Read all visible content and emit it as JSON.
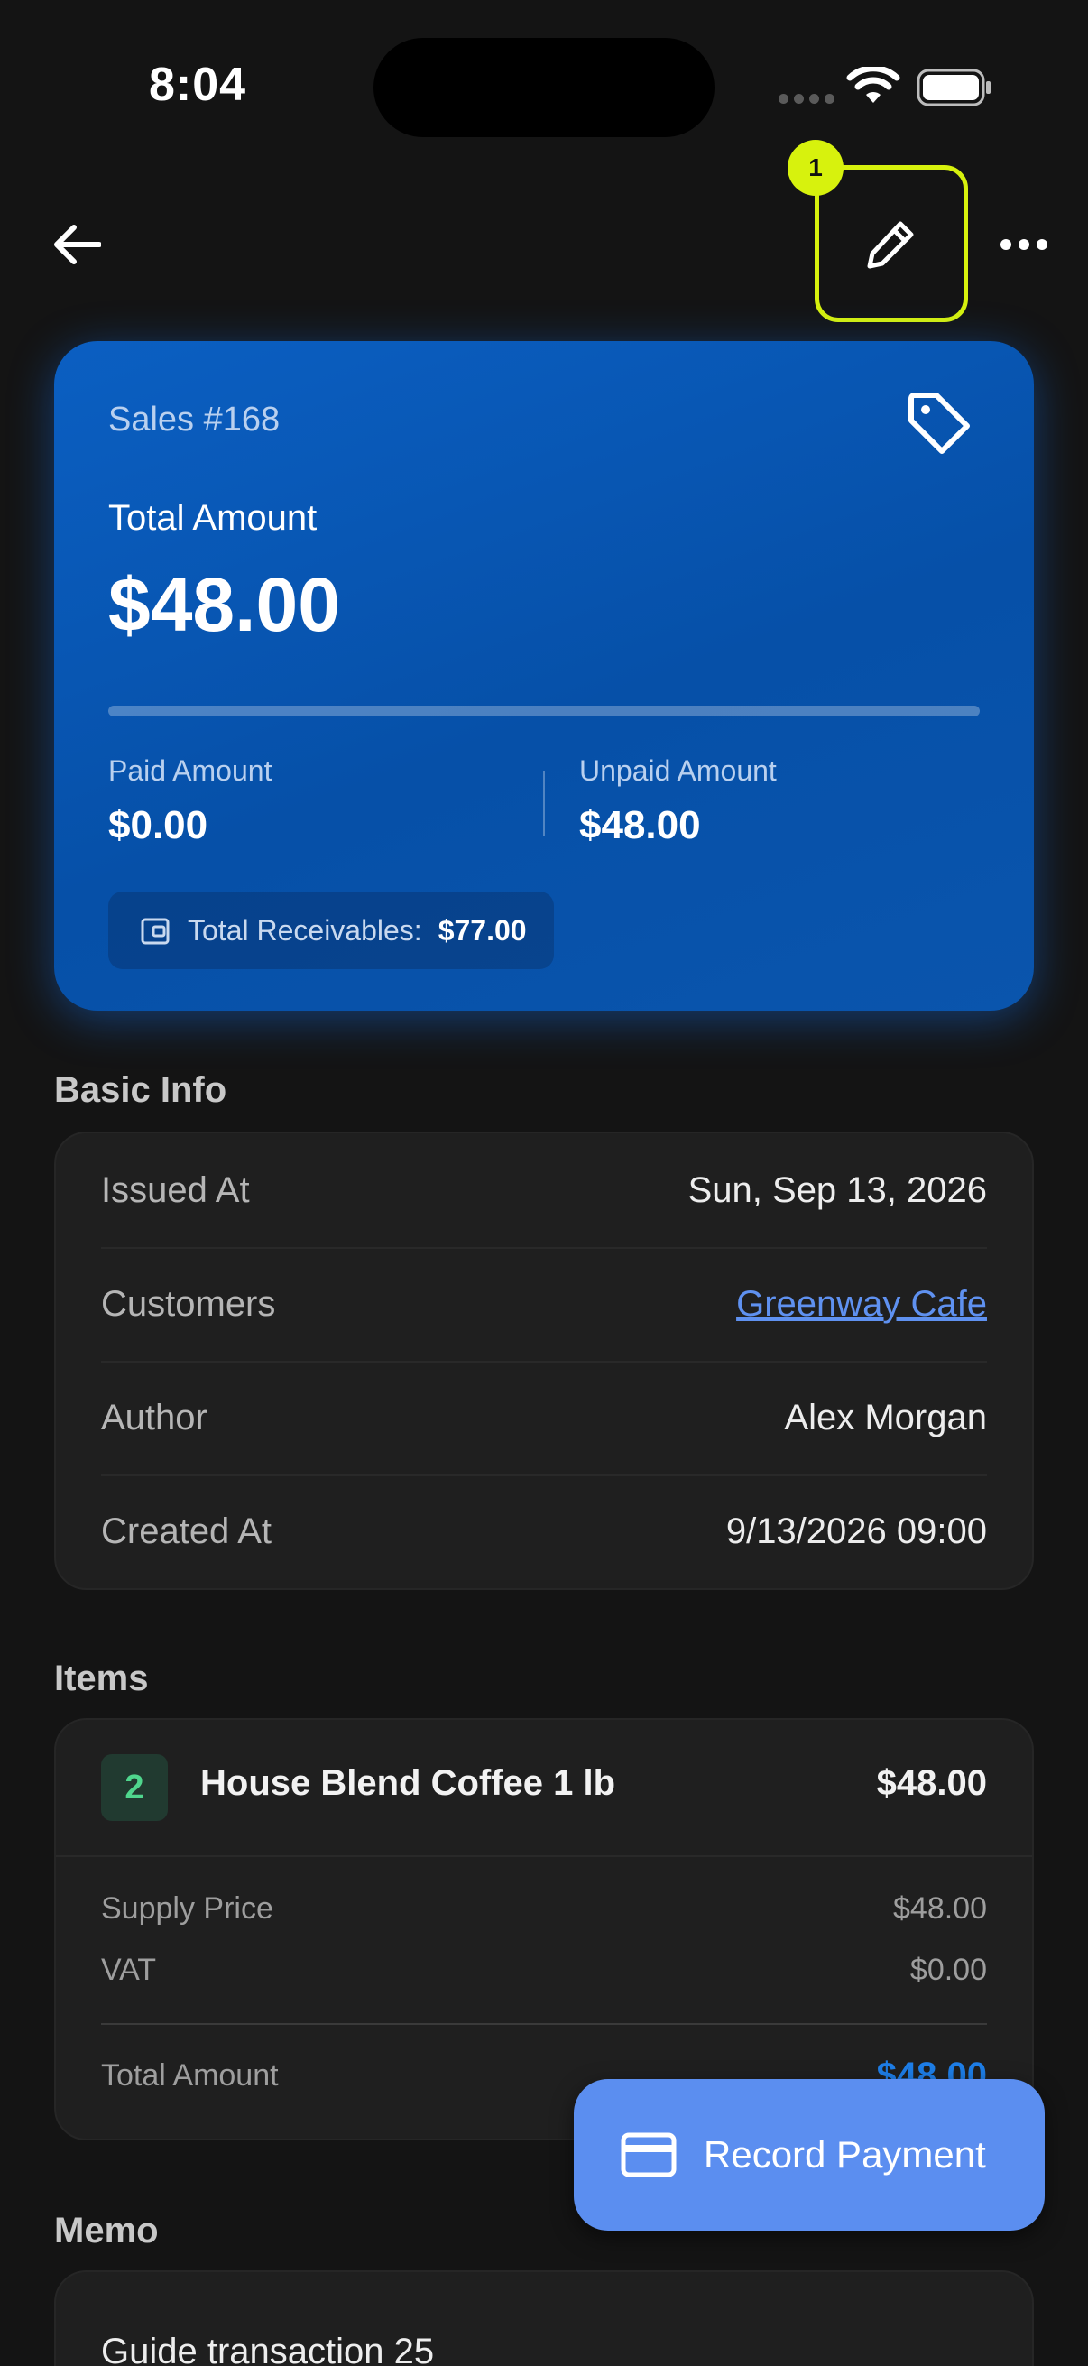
{
  "status_bar": {
    "time": "8:04"
  },
  "nav": {
    "edit_badge": "1"
  },
  "summary": {
    "sale_number": "Sales #168",
    "total_label": "Total Amount",
    "total_value": "$48.00",
    "paid_fraction": 0,
    "paid_label": "Paid Amount",
    "paid_value": "$0.00",
    "unpaid_label": "Unpaid Amount",
    "unpaid_value": "$48.00",
    "receivables_label": "Total Receivables:",
    "receivables_value": "$77.00"
  },
  "basic_info": {
    "title": "Basic Info",
    "rows": [
      {
        "key": "Issued At",
        "value": "Sun, Sep 13, 2026"
      },
      {
        "key": "Customers",
        "value": "Greenway Cafe"
      },
      {
        "key": "Author",
        "value": "Alex Morgan"
      },
      {
        "key": "Created At",
        "value": "9/13/2026 09:00"
      }
    ]
  },
  "items": {
    "title": "Items",
    "list": [
      {
        "qty": "2",
        "name": "House Blend Coffee 1 lb",
        "price": "$48.00",
        "supply_label": "Supply Price",
        "supply_value": "$48.00",
        "vat_label": "VAT",
        "vat_value": "$0.00",
        "total_label": "Total Amount",
        "total_value": "$48.00"
      }
    ]
  },
  "memo": {
    "title": "Memo",
    "text": "Guide transaction 25"
  },
  "fab": {
    "label": "Record Payment"
  },
  "colors": {
    "accent": "#0a5bc0",
    "highlight": "#d7f20d",
    "fab": "#5b8ef0",
    "link": "#5f91f0"
  }
}
